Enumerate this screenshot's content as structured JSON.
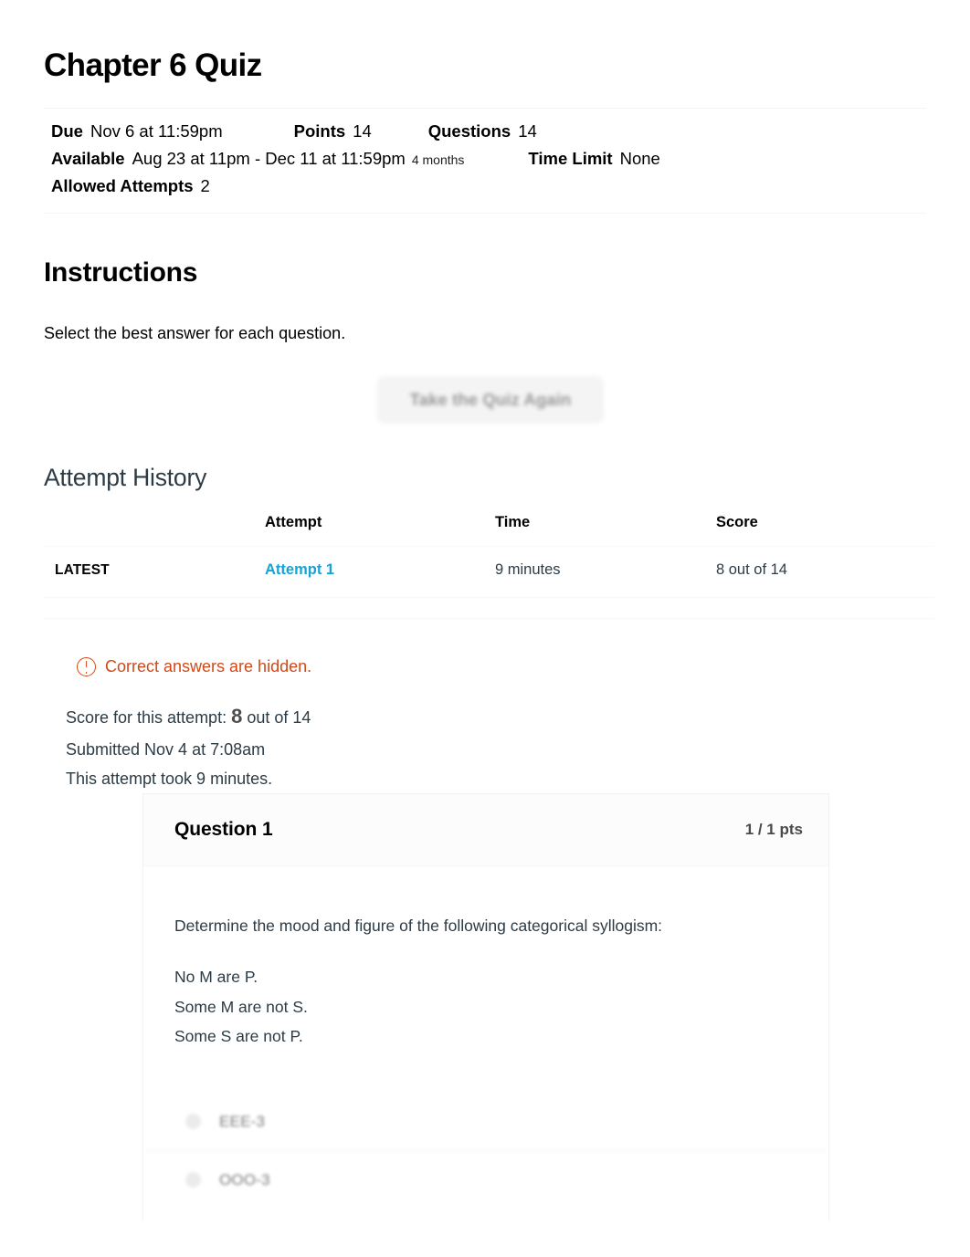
{
  "quiz": {
    "title": "Chapter 6 Quiz",
    "meta": {
      "due_label": "Due",
      "due_value": "Nov 6 at 11:59pm",
      "points_label": "Points",
      "points_value": "14",
      "questions_label": "Questions",
      "questions_value": "14",
      "available_label": "Available",
      "available_value": "Aug 23 at 11pm - Dec 11 at 11:59pm",
      "available_duration": "4 months",
      "time_limit_label": "Time Limit",
      "time_limit_value": "None",
      "allowed_attempts_label": "Allowed Attempts",
      "allowed_attempts_value": "2"
    }
  },
  "instructions": {
    "heading": "Instructions",
    "text": "Select the best answer for each question."
  },
  "actions": {
    "retake_label": "Take the Quiz Again"
  },
  "attempt_history": {
    "heading": "Attempt History",
    "columns": {
      "latest": "",
      "attempt": "Attempt",
      "time": "Time",
      "score": "Score"
    },
    "rows": [
      {
        "latest": "LATEST",
        "attempt": "Attempt 1",
        "time": "9 minutes",
        "score": "8 out of 14"
      }
    ]
  },
  "notice": {
    "icon": "warning-circle-icon",
    "text": "Correct answers are hidden.",
    "color": "#cf4a1b"
  },
  "attempt_summary": {
    "score_prefix": "Score for this attempt:",
    "score_value": "8",
    "score_suffix": "out of 14",
    "submitted": "Submitted Nov 4 at 7:08am",
    "duration": "This attempt took 9 minutes."
  },
  "question": {
    "name": "Question 1",
    "points": "1 / 1 pts",
    "prompt": "Determine the mood and figure of the following categorical syllogism:",
    "premises": [
      "No M are P.",
      "Some M are not S.",
      "Some S are not P."
    ],
    "answers": [
      {
        "label": "EEE-3"
      },
      {
        "label": "OOO-3"
      }
    ]
  },
  "colors": {
    "link": "#17a3d6",
    "warning": "#cf4a1b",
    "text": "#2d3b45",
    "muted": "#6d6f71"
  }
}
